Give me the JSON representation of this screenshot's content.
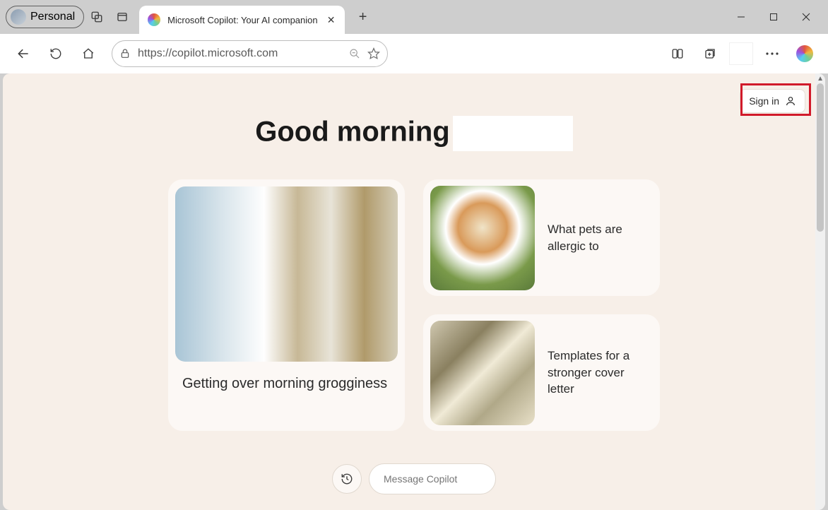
{
  "browser": {
    "profile_label": "Personal",
    "tab_title": "Microsoft Copilot: Your AI companion",
    "url": "https://copilot.microsoft.com"
  },
  "page": {
    "signin_label": "Sign in",
    "greeting": "Good morning",
    "cards": {
      "large": {
        "title": "Getting over morning grogginess"
      },
      "small": [
        {
          "title": "What pets are allergic to"
        },
        {
          "title": "Templates for a stronger cover letter"
        }
      ]
    },
    "input_placeholder": "Message Copilot"
  }
}
